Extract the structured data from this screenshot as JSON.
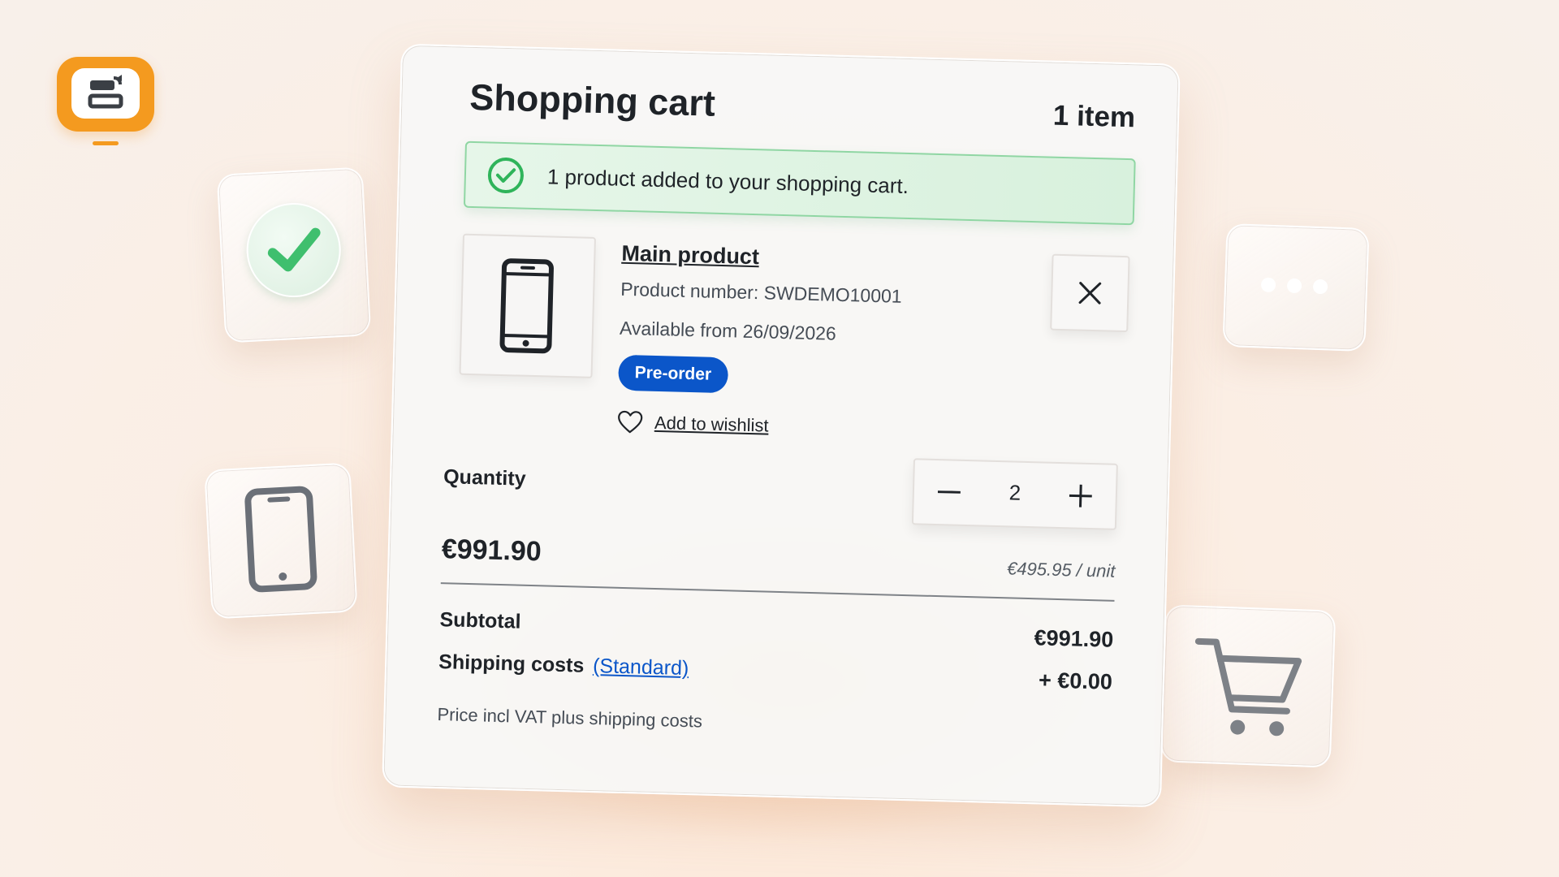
{
  "cart": {
    "title": "Shopping cart",
    "item_count": "1 item"
  },
  "alert": {
    "message": "1 product added to your shopping cart.",
    "icon": "check-circle-icon",
    "color": "#2fb45a"
  },
  "product": {
    "title": "Main product",
    "number": "Product number: SWDEMO10001",
    "availability": "Available from 26/09/2026",
    "badge": "Pre-order",
    "badge_color": "#0b56c9",
    "wishlist_label": "Add to wishlist",
    "image_icon": "smartphone-icon"
  },
  "quantity": {
    "label": "Quantity",
    "value": "2"
  },
  "pricing": {
    "line_total": "€991.90",
    "unit_price": "€495.95 / unit"
  },
  "summary": {
    "subtotal_label": "Subtotal",
    "subtotal_value": "€991.90",
    "shipping_label": "Shipping costs",
    "shipping_method": "(Standard)",
    "shipping_value": "+ €0.00",
    "vat_note": "Price incl VAT plus shipping costs"
  },
  "decor": {
    "brand_color": "#f49a1f",
    "tiles": [
      "checkmark-icon",
      "smartphone-icon",
      "chat-bubble-icon",
      "shopping-cart-icon"
    ]
  }
}
